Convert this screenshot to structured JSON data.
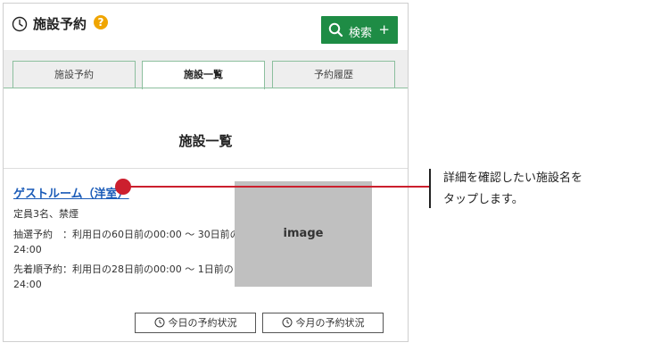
{
  "header": {
    "title": "施設予約",
    "help_label": "?",
    "search_label": "検索",
    "search_plus": "+"
  },
  "tabs": [
    {
      "label": "施設予約"
    },
    {
      "label": "施設一覧"
    },
    {
      "label": "予約履歴"
    }
  ],
  "section_title": "施設一覧",
  "facility": {
    "name": "ゲストルーム（洋室）",
    "capacity": "定員3名、禁煙",
    "lottery_line1": "抽選予約　：利用日の60日前の00:00 ～ 30日前の",
    "lottery_line2": "24:00",
    "first_line1": "先着順予約：利用日の28日前の00:00 ～ 1日前の",
    "first_line2": "24:00",
    "image_label": "image"
  },
  "status_buttons": {
    "today": "今日の予約状況",
    "month": "今月の予約状況"
  },
  "callout": {
    "line1": "詳細を確認したい施設名を",
    "line2": "タップします。"
  },
  "colors": {
    "accent_green": "#1e8c45",
    "link_blue": "#1a5bb8",
    "pointer_red": "#cc1f2e",
    "help_orange": "#f0a500"
  }
}
